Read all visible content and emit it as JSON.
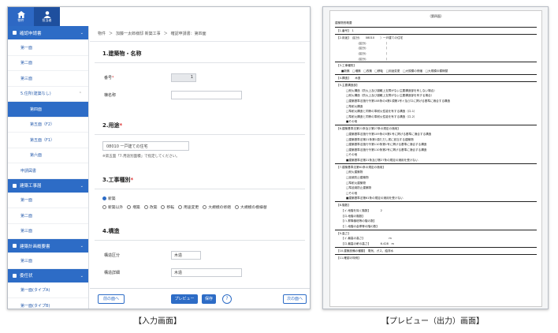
{
  "input_screen": {
    "nav": {
      "home_label": "物件",
      "user_label": "担当者"
    },
    "sidebar": {
      "sections": [
        {
          "label": "確認申請書",
          "items": [
            "第一面",
            "第二面",
            "第三面"
          ]
        },
        {
          "label": "",
          "items": []
        },
        {
          "label": "建築工事届",
          "items": [
            "第一面",
            "第二面",
            "第三面"
          ]
        },
        {
          "label": "建築計画概要書",
          "items": [
            "第三面"
          ]
        },
        {
          "label": "委任状",
          "items": [
            "第一面(タイプA)",
            "第一面(タイプB)"
          ]
        }
      ],
      "group_item": "5.住所(建築なし)",
      "sub_items": [
        "第四面",
        "第五面（F2）",
        "第五面（F1）",
        "第六面"
      ],
      "extra_item": "申請図書",
      "active_item": "第四面"
    },
    "breadcrumb": [
      "物件",
      "＞",
      "加藤一太郎様邸 新築工事",
      "＞",
      "確認申請書：第四面"
    ],
    "sections": {
      "s1": {
        "title": "1.建築物・名称",
        "field1_label": "番号",
        "field1_value": "1",
        "field2_label": "棟名称"
      },
      "s2": {
        "title": "2.用途",
        "value": "08010 一戸建ての住宅",
        "note": "※第五面「7.用途別面積」で指定してください。"
      },
      "s3": {
        "title": "3.工事種別",
        "opt_selected": "新築",
        "options": [
          "新築以外",
          "増築",
          "改築",
          "移転",
          "用途変更",
          "大規模の修繕",
          "大規模の模様替"
        ]
      },
      "s4": {
        "title": "4.構造",
        "field1_label": "構造区分",
        "field1_value": "木造",
        "field2_label": "構造詳細",
        "field2_value": "木造"
      }
    },
    "footer": {
      "prev": "前の面へ",
      "preview": "プレビュー",
      "save": "保存",
      "help": "?",
      "next": "次の面へ"
    }
  },
  "preview_screen": {
    "doc_title": "（第四面）",
    "header": "建築物別概要",
    "lines": [
      "【1.番号】　1",
      "【2.用途】　(区分)　　08010　　）一戸建ての住宅",
      "　　　　　　(区分)　　　　　　　）",
      "　　　　　　(区分)　　　　　　　）",
      "　　　　　　(区分)　　　　　　　）",
      "　　　　　　(区分)　　　　　　　）",
      "【3.工事種別】",
      "■新築　□増築　□改築　□移転　□用途変更　□大規模の修繕　□大規模の模様替",
      "【4.構造】　　木造",
      "【5.主要構造部】",
      "□耐火構造（防火上及び避難上支障がない主要構造部を有しない場合）",
      "□耐火構造（防火上及び避難上支障がない主要構造部を有する場合）",
      "□建築基準法施行令第108条の4第1項第1号イ及びロに掲げる基準に適合する構造",
      "□準耐火構造",
      "□準耐火構造と同等の準耐火性能を有する構造（ロ-1）",
      "□準耐火構造と同等の準耐火性能を有する構造（ロ-2）",
      "■その他",
      "【6.建築基準法第21条及び第27条の規定の適用】",
      "□建築基準法施行令第109条の5第1号に掲げる基準に適合する構造",
      "□建築基準法第21条第1項ただし書に該当する建築物",
      "□建築基準法施行令第110条第1号に掲げる基準に適合する構造",
      "□建築基準法施行令第110条第2号に掲げる基準に適合する構造",
      "□その他",
      "■建築基準法第21条及び第27条の規定の適用を受けない",
      "【7.建築基準法第61条の規定の適用】",
      "□耐火建築物",
      "□延焼防止建築物",
      "□準耐火建築物",
      "□準延焼防止建築物",
      "□その他",
      "■建築基準法第61条の規定の適用を受けない",
      "【8.階数】",
      "【イ.地階を除く階数】　　　　2",
      "【ロ.地階の階数】",
      "【ハ.昇降機塔等の階の数】",
      "【ニ.地階の倉庫等の階の数】",
      "【9.高さ】",
      "【イ.最高の高さ】　　　　　　　　　m",
      "【ロ.最高の軒の高さ】　　　　6.428　m",
      "【10.建築設備の種類】　電気、ガス、給排水",
      "【11.確認の特例】"
    ]
  },
  "captions": {
    "input": "【入力画面】",
    "preview": "【プレビュー（出力）画面】"
  },
  "colors": {
    "primary": "#2d6cc6",
    "nav": "#1e4f9e"
  }
}
